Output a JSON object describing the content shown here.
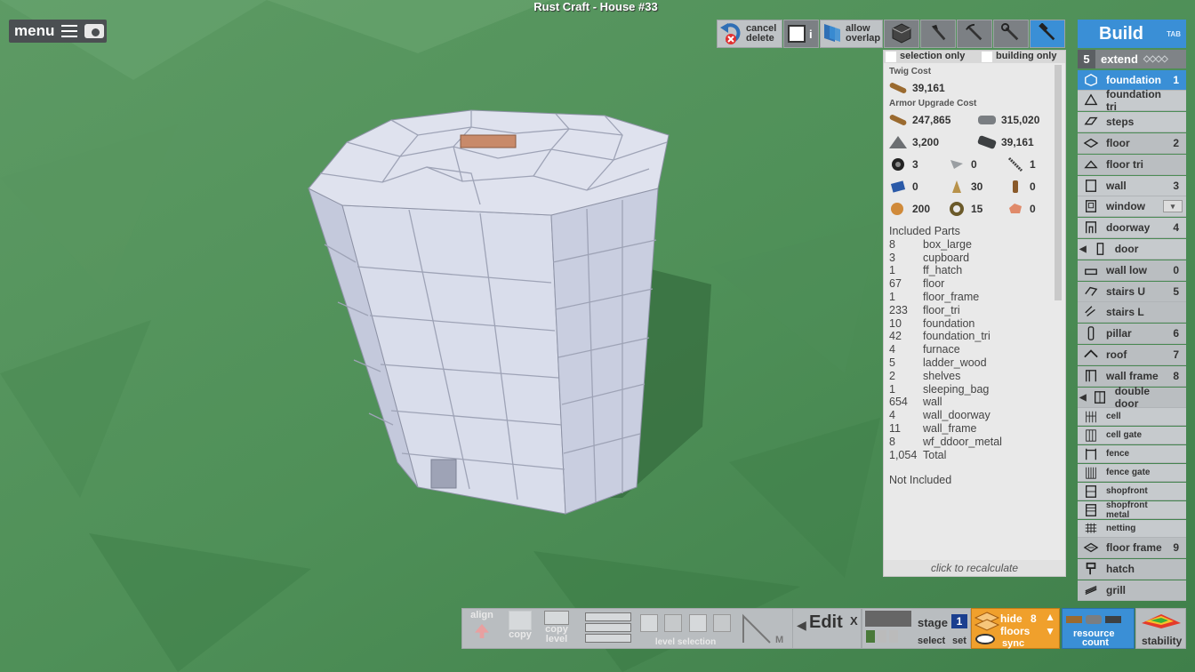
{
  "window": {
    "title": "Rust Craft - House #33"
  },
  "menu": {
    "label": "menu",
    "hamburger_icon": "hamburger-icon",
    "screenshot_icon": "camera-icon"
  },
  "toolbar": {
    "cancel_line1": "cancel",
    "cancel_line2": "delete",
    "allow_line1": "allow",
    "allow_line2": "overlap",
    "info_glyph": "i",
    "tools": [
      "cube-icon",
      "hatchet-icon",
      "pickaxe-icon",
      "wrench-icon",
      "hammer-icon"
    ]
  },
  "build": {
    "title": "Build",
    "tab_hint": "TAB",
    "extend_count": "5",
    "extend_label": "extend",
    "items": [
      {
        "label": "foundation",
        "key": "1"
      },
      {
        "label": "foundation tri",
        "key": ""
      },
      {
        "label": "steps",
        "key": ""
      },
      {
        "label": "floor",
        "key": "2"
      },
      {
        "label": "floor tri",
        "key": ""
      },
      {
        "label": "wall",
        "key": "3"
      },
      {
        "label": "window",
        "key": ""
      },
      {
        "label": "doorway",
        "key": "4"
      },
      {
        "label": "door",
        "key": ""
      },
      {
        "label": "wall low",
        "key": "0"
      },
      {
        "label": "stairs U",
        "key": "5"
      },
      {
        "label": "stairs L",
        "key": ""
      },
      {
        "label": "pillar",
        "key": "6"
      },
      {
        "label": "roof",
        "key": "7"
      },
      {
        "label": "wall frame",
        "key": "8"
      },
      {
        "label": "double door",
        "key": ""
      },
      {
        "label": "cell",
        "key": ""
      },
      {
        "label": "cell gate",
        "key": ""
      },
      {
        "label": "fence",
        "key": ""
      },
      {
        "label": "fence gate",
        "key": ""
      },
      {
        "label": "shopfront",
        "key": ""
      },
      {
        "label": "shopfront metal",
        "key": ""
      },
      {
        "label": "netting",
        "key": ""
      },
      {
        "label": "floor frame",
        "key": "9"
      },
      {
        "label": "hatch",
        "key": ""
      },
      {
        "label": "grill",
        "key": ""
      }
    ]
  },
  "cost": {
    "selection_only": "selection only",
    "building_only": "building only",
    "twig_head": "Twig Cost",
    "twig_value": "39,161",
    "armor_head": "Armor Upgrade Cost",
    "armor": [
      [
        "247,865",
        "315,020"
      ],
      [
        "3,200",
        "39,161"
      ]
    ],
    "small": [
      [
        "3",
        "0",
        "1"
      ],
      [
        "0",
        "30",
        "0"
      ],
      [
        "200",
        "15",
        "0"
      ]
    ],
    "included_head": "Included Parts",
    "parts": [
      {
        "n": "8",
        "name": "box_large"
      },
      {
        "n": "3",
        "name": "cupboard"
      },
      {
        "n": "1",
        "name": "ff_hatch"
      },
      {
        "n": "67",
        "name": "floor"
      },
      {
        "n": "1",
        "name": "floor_frame"
      },
      {
        "n": "233",
        "name": "floor_tri"
      },
      {
        "n": "10",
        "name": "foundation"
      },
      {
        "n": "42",
        "name": "foundation_tri"
      },
      {
        "n": "4",
        "name": "furnace"
      },
      {
        "n": "5",
        "name": "ladder_wood"
      },
      {
        "n": "2",
        "name": "shelves"
      },
      {
        "n": "1",
        "name": "sleeping_bag"
      },
      {
        "n": "654",
        "name": "wall"
      },
      {
        "n": "4",
        "name": "wall_doorway"
      },
      {
        "n": "11",
        "name": "wall_frame"
      },
      {
        "n": "8",
        "name": "wf_ddoor_metal"
      },
      {
        "n": "1,054",
        "name": "Total"
      }
    ],
    "not_included": "Not Included",
    "recalc": "click to recalculate"
  },
  "bottom": {
    "align": "align",
    "copy": "copy",
    "copy_level_1": "copy",
    "copy_level_2": "level",
    "level_selection": "level selection",
    "m_key": "M",
    "edit": "Edit",
    "close": "X",
    "stage": "stage",
    "stage_num": "1",
    "select": "select",
    "set": "set",
    "hide": "hide",
    "floors": "floors",
    "hide_num": "8",
    "sync": "sync",
    "resource_1": "resource",
    "resource_2": "count",
    "stability": "stability"
  }
}
